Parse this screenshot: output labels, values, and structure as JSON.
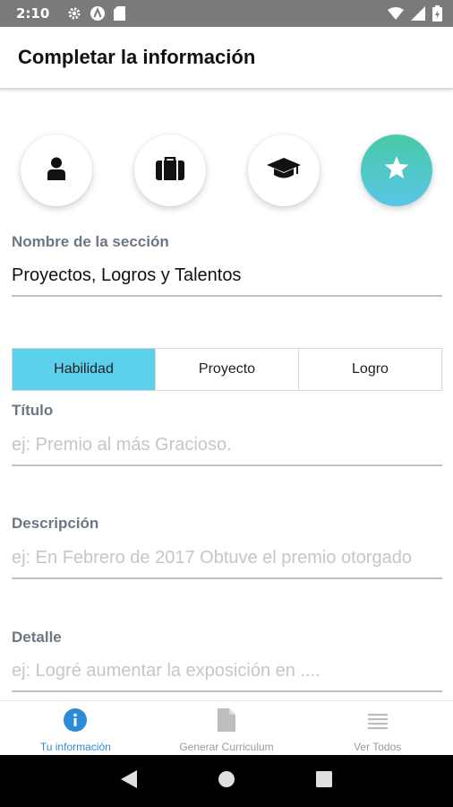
{
  "status_bar": {
    "time": "2:10",
    "icons": [
      "settings-icon",
      "a-circle-icon",
      "sd-card-icon",
      "wifi-icon",
      "signal-icon",
      "battery-icon"
    ]
  },
  "app_bar": {
    "title": "Completar la información"
  },
  "steps": [
    {
      "name": "personal",
      "icon": "person-icon",
      "active": false
    },
    {
      "name": "experience",
      "icon": "briefcase-icon",
      "active": false
    },
    {
      "name": "education",
      "icon": "graduation-cap-icon",
      "active": false
    },
    {
      "name": "talents",
      "icon": "star-icon",
      "active": true
    }
  ],
  "section": {
    "label": "Nombre de la sección",
    "value": "Proyectos, Logros y Talentos"
  },
  "segments": {
    "items": [
      "Habilidad",
      "Proyecto",
      "Logro"
    ],
    "selected": "Habilidad"
  },
  "fields": {
    "titulo": {
      "label": "Título",
      "placeholder": "ej: Premio al más Gracioso."
    },
    "descripcion": {
      "label": "Descripción",
      "placeholder": "ej: En Febrero de 2017 Obtuve el premio otorgado"
    },
    "detalle": {
      "label": "Detalle",
      "placeholder": "ej: Logré aumentar la exposición en ...."
    }
  },
  "bottom_nav": {
    "items": [
      {
        "label": "Tu información",
        "icon": "info-icon",
        "active": true
      },
      {
        "label": "Generar Curriculum",
        "icon": "document-icon",
        "active": false
      },
      {
        "label": "Ver Todos",
        "icon": "list-icon",
        "active": false
      }
    ]
  },
  "colors": {
    "accent": "#5bd0ec",
    "active_step_gradient": [
      "#48c9a8",
      "#5ac6e6"
    ],
    "nav_active": "#2d8bd6",
    "label": "#6b7785",
    "placeholder": "#c3c6ca"
  }
}
